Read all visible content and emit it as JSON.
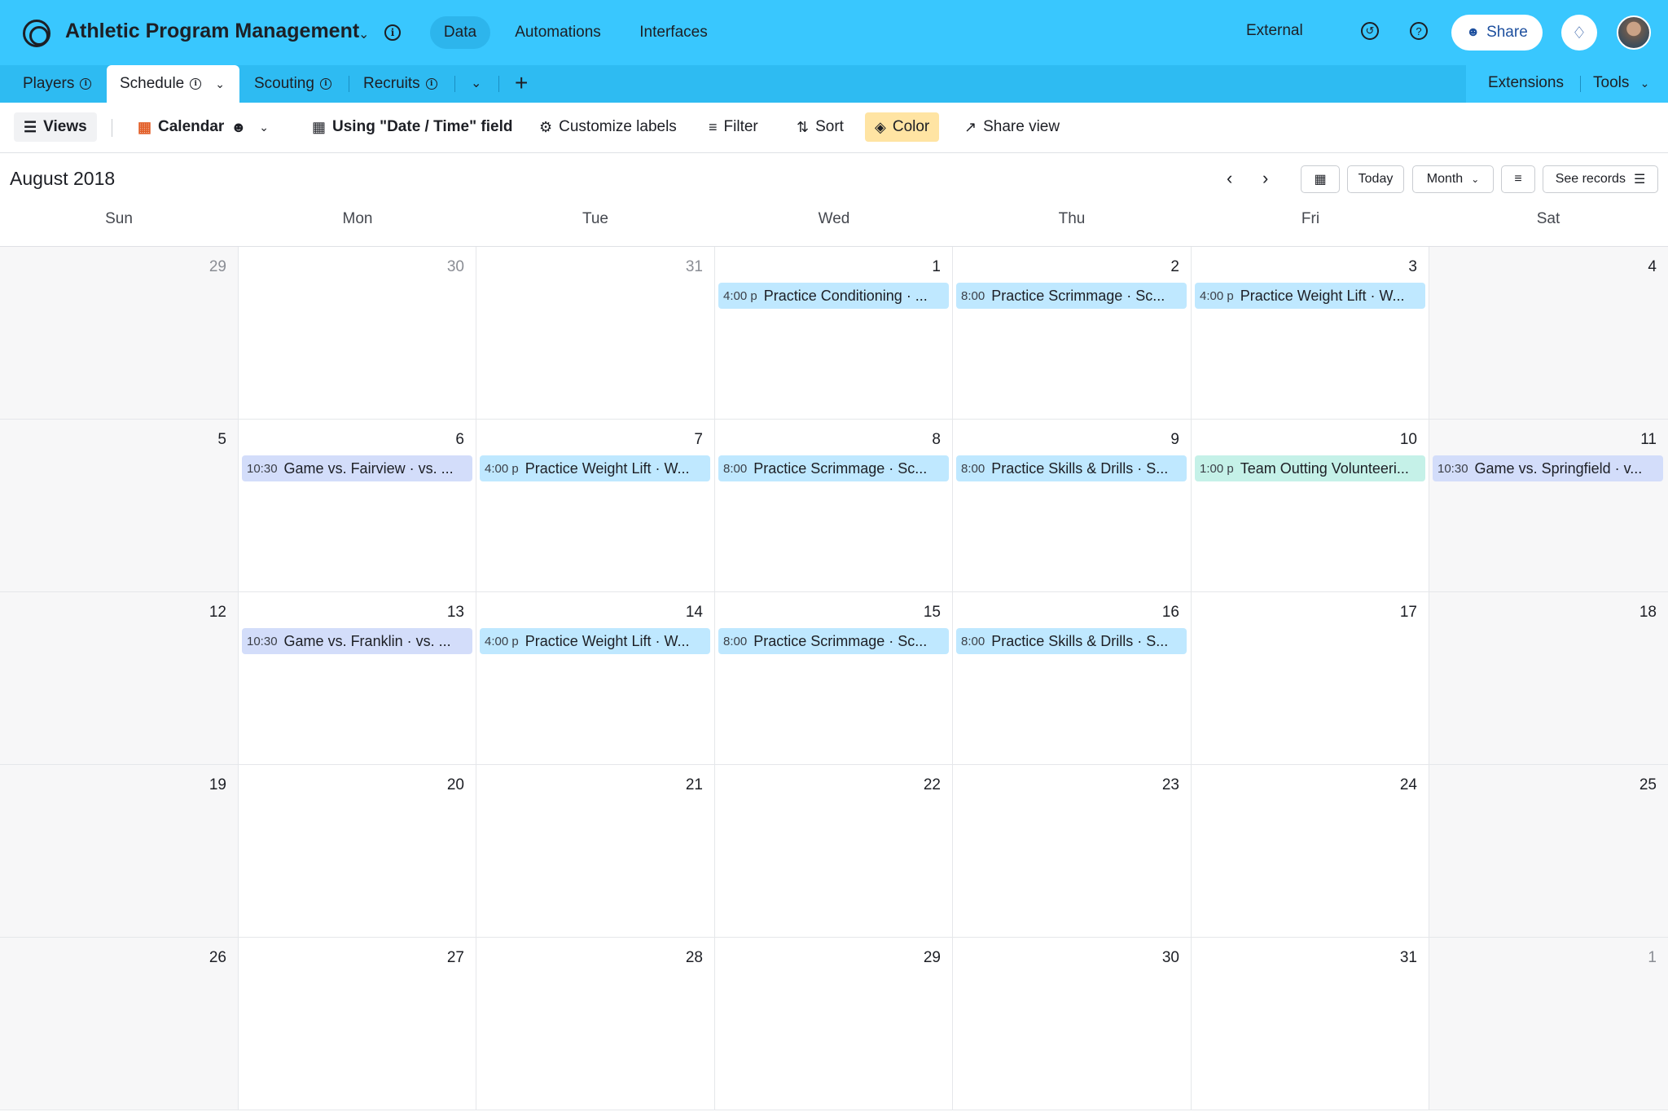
{
  "header": {
    "base_title": "Athletic Program Management",
    "nav": [
      "Data",
      "Automations",
      "Interfaces"
    ],
    "active_nav": "Data",
    "external_label": "External",
    "share_label": "Share"
  },
  "tables": {
    "tabs": [
      "Players",
      "Schedule",
      "Scouting",
      "Recruits"
    ],
    "active": "Schedule",
    "extensions_label": "Extensions",
    "tools_label": "Tools"
  },
  "toolbar": {
    "views_label": "Views",
    "view_name": "Calendar",
    "date_field_label": "Using \"Date / Time\" field",
    "customize_labels": "Customize labels",
    "filter_label": "Filter",
    "sort_label": "Sort",
    "color_label": "Color",
    "share_view_label": "Share view"
  },
  "calendar": {
    "month_title": "August 2018",
    "today_label": "Today",
    "month_label": "Month",
    "see_records_label": "See records",
    "weekdays": [
      "Sun",
      "Mon",
      "Tue",
      "Wed",
      "Thu",
      "Fri",
      "Sat"
    ],
    "weeks": [
      [
        {
          "day": "29",
          "outside": true
        },
        {
          "day": "30",
          "outside": true
        },
        {
          "day": "31",
          "outside": true
        },
        {
          "day": "1",
          "event": {
            "time": "4:00 p",
            "title": "Practice Conditioning · ...",
            "color": "blue"
          }
        },
        {
          "day": "2",
          "event": {
            "time": "8:00",
            "title": "Practice Scrimmage · Sc...",
            "color": "blue"
          }
        },
        {
          "day": "3",
          "event": {
            "time": "4:00 p",
            "title": "Practice Weight Lift · W...",
            "color": "blue"
          }
        },
        {
          "day": "4"
        }
      ],
      [
        {
          "day": "5"
        },
        {
          "day": "6",
          "event": {
            "time": "10:30",
            "title": "Game vs. Fairview · vs. ...",
            "color": "purple"
          }
        },
        {
          "day": "7",
          "event": {
            "time": "4:00 p",
            "title": "Practice Weight Lift · W...",
            "color": "blue"
          }
        },
        {
          "day": "8",
          "event": {
            "time": "8:00",
            "title": "Practice Scrimmage · Sc...",
            "color": "blue"
          }
        },
        {
          "day": "9",
          "event": {
            "time": "8:00",
            "title": "Practice Skills & Drills · S...",
            "color": "blue"
          }
        },
        {
          "day": "10",
          "event": {
            "time": "1:00 p",
            "title": "Team Outting Volunteeri...",
            "color": "teal"
          }
        },
        {
          "day": "11",
          "event": {
            "time": "10:30",
            "title": "Game vs. Springfield · v...",
            "color": "purple"
          }
        }
      ],
      [
        {
          "day": "12"
        },
        {
          "day": "13",
          "event": {
            "time": "10:30",
            "title": "Game vs. Franklin · vs. ...",
            "color": "purple"
          }
        },
        {
          "day": "14",
          "event": {
            "time": "4:00 p",
            "title": "Practice Weight Lift · W...",
            "color": "blue"
          }
        },
        {
          "day": "15",
          "event": {
            "time": "8:00",
            "title": "Practice Scrimmage · Sc...",
            "color": "blue"
          }
        },
        {
          "day": "16",
          "event": {
            "time": "8:00",
            "title": "Practice Skills & Drills · S...",
            "color": "blue"
          }
        },
        {
          "day": "17"
        },
        {
          "day": "18"
        }
      ],
      [
        {
          "day": "19"
        },
        {
          "day": "20"
        },
        {
          "day": "21"
        },
        {
          "day": "22"
        },
        {
          "day": "23"
        },
        {
          "day": "24"
        },
        {
          "day": "25"
        }
      ],
      [
        {
          "day": "26"
        },
        {
          "day": "27"
        },
        {
          "day": "28"
        },
        {
          "day": "29"
        },
        {
          "day": "30"
        },
        {
          "day": "31"
        },
        {
          "day": "1",
          "outside": true
        }
      ]
    ]
  },
  "colors": {
    "header_bg": "#39c7fe",
    "tabbar_bg": "#2ebbf2",
    "event_blue": "#bfe8ff",
    "event_purple": "#d3ddfa",
    "event_teal": "#c5f1e8",
    "color_button_bg": "#ffe4a3"
  },
  "icons": {
    "logo": "base-logo-icon",
    "history": "history-icon",
    "help": "help-icon",
    "notifications": "bell-icon"
  }
}
